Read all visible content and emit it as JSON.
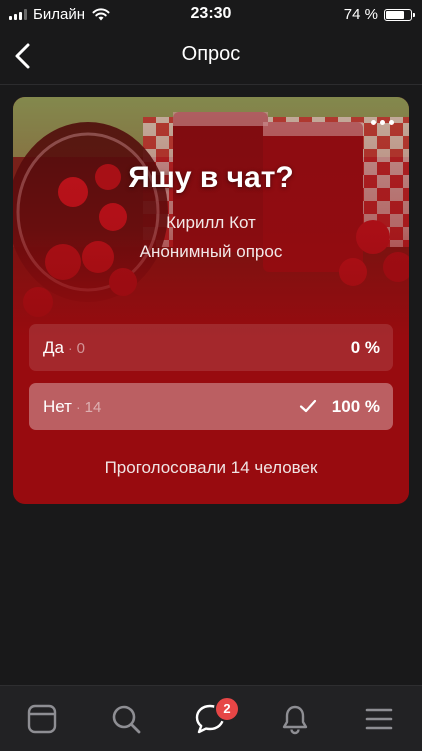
{
  "status_bar": {
    "carrier": "Билайн",
    "time": "23:30",
    "battery": "74 %",
    "battery_level": 0.74
  },
  "nav": {
    "title": "Опрос"
  },
  "poll": {
    "title": "Яшу в чат?",
    "author": "Кирилл Кот",
    "type": "Анонимный опрос",
    "options": [
      {
        "label": "Да",
        "count": "0",
        "percent": "0 %",
        "share": 0,
        "checked": false
      },
      {
        "label": "Нет",
        "count": "14",
        "percent": "100 %",
        "share": 1,
        "checked": true
      }
    ],
    "votes_summary": "Проголосовали 14 человек"
  },
  "tabbar": {
    "badge": "2"
  },
  "colors": {
    "card": "#980b0f",
    "background": "#19191a",
    "badge": "#e64646",
    "tabbar": "#222224"
  }
}
